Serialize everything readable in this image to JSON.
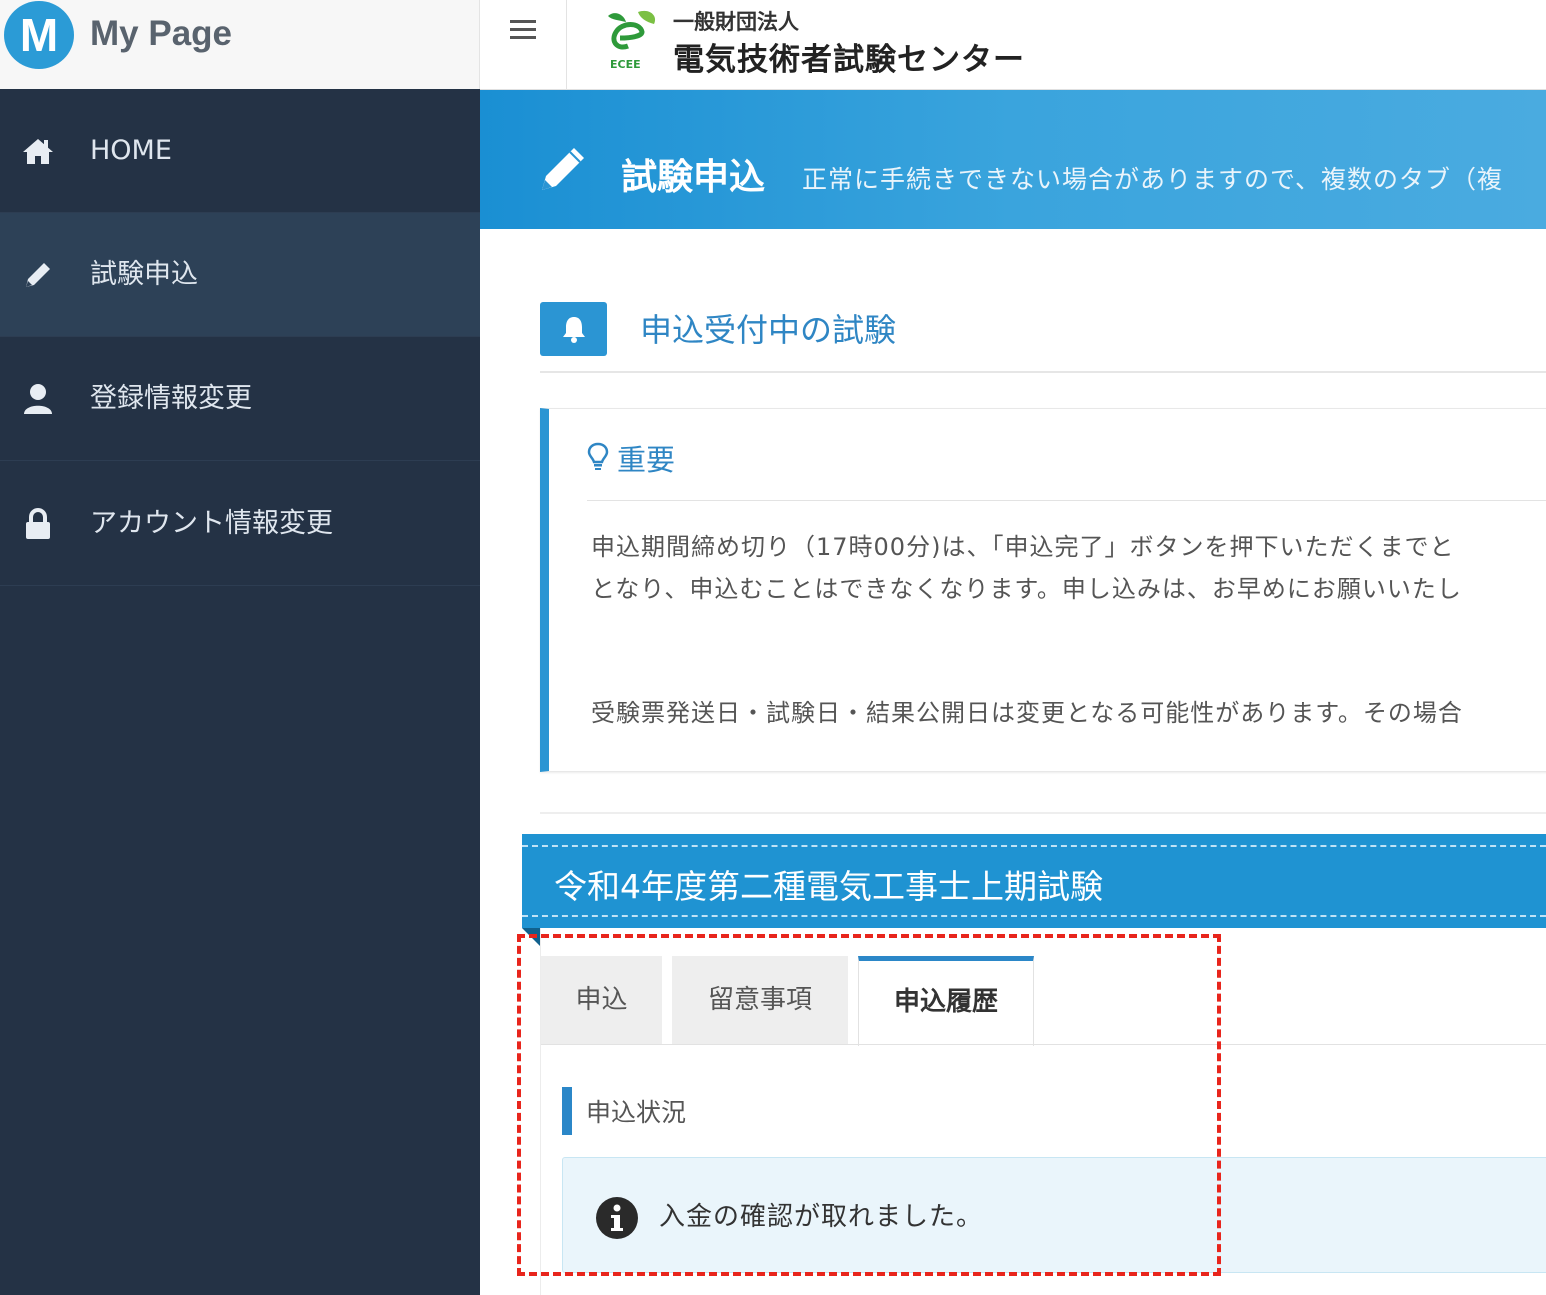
{
  "brand": {
    "logo_letter": "M",
    "title": "My Page"
  },
  "sidebar": {
    "items": [
      {
        "label": "HOME",
        "icon": "home-icon"
      },
      {
        "label": "試験申込",
        "icon": "pencil-icon",
        "active": true
      },
      {
        "label": "登録情報変更",
        "icon": "user-icon"
      },
      {
        "label": "アカウント情報変更",
        "icon": "lock-icon"
      }
    ]
  },
  "header": {
    "org_small": "一般財団法人",
    "org_main": "電気技術者試験センター",
    "org_logo_text": "ECEE"
  },
  "banner": {
    "title": "試験申込",
    "subtitle": "正常に手続きできない場合がありますので、複数のタブ（複"
  },
  "section": {
    "title": "申込受付中の試験"
  },
  "notice": {
    "title": "重要",
    "line1": "申込期間締め切り（17時00分)は、「申込完了」ボタンを押下いただくまでと",
    "line2": "となり、申込むことはできなくなります。申し込みは、お早めにお願いいたし",
    "line3": "受験票発送日・試験日・結果公開日は変更となる可能性があります。その場合"
  },
  "exam": {
    "title": "令和4年度第二種電気工事士上期試験",
    "tabs": [
      {
        "label": "申込"
      },
      {
        "label": "留意事項"
      },
      {
        "label": "申込履歴",
        "active": true
      }
    ],
    "status_label": "申込状況",
    "alert_text": "入金の確認が取れました。"
  },
  "colors": {
    "sidebar": "#243245",
    "accent": "#2b95d3",
    "highlight": "#e8251c"
  }
}
